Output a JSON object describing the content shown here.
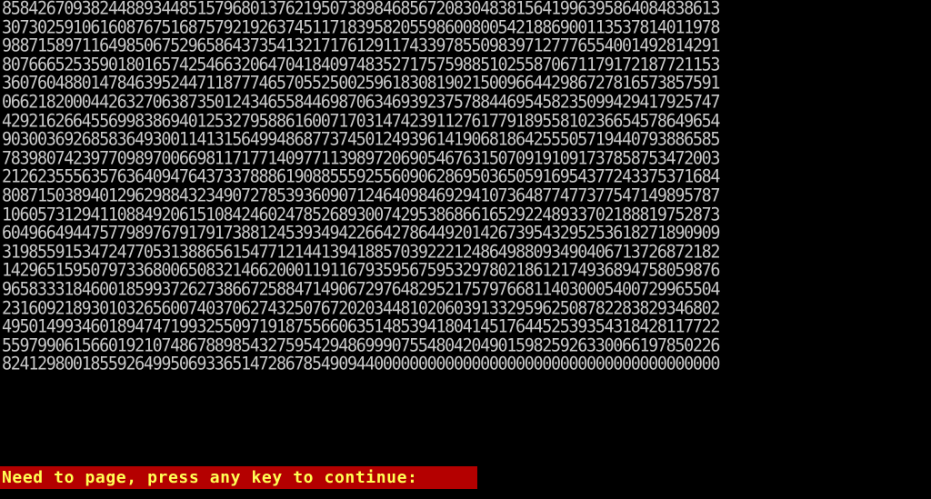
{
  "terminal": {
    "lines": [
      "858426709382448893448515796801376219507389846856720830483815641996395864084838613",
      "307302591061608767516875792192637451171839582055986008005421886900113537814011978",
      "988715897116498506752965864373541321717612911743397855098397127776554001492814291",
      "807666525359018016574254663206470418409748352717575988510255870671179172187721153",
      "360760488014784639524471187774657055250025961830819021500966442986727816573857591",
      "066218200044263270638735012434655844698706346939237578844695458235099429417925747",
      "429216266455699838694012532795886160071703147423911276177918955810236654578649654",
      "903003692685836493001141315649948687737450124939614190681864255505719440793886585",
      "783980742397709897006698117177140977113989720690546763150709191091737858753472003",
      "212623555635763640947643733788861908855592556090628695036505916954377243375371684",
      "808715038940129629884323490727853936090712464098469294107364877477377547149895787",
      "106057312941108849206151084246024785268930074295386866165292248933702188819752873",
      "604966494475779897679179173881245393494226642786449201426739543295253618271890909",
      "319855915347247705313886561547712144139418857039222124864988093490406713726872182",
      "142965159507973368006508321466200011911679359567595329780218612174936894758059876",
      "965833318460018599372627386672588471490672976482952175797668114030005400729965504",
      "231609218930103265600740370627432507672020344810206039133295962508782283829346802",
      "495014993460189474719932550971918755660635148539418041451764452539354318428117722",
      "559799061566019210748678898543275954294869990755480420490159825926330066197850226",
      "824129800185592649950693365147286785490944000000000000000000000000000000000000000"
    ],
    "prompt": "Need to page, press any key to continue:"
  },
  "colors": {
    "background": "#000000",
    "text": "#c8c8c8",
    "prompt_background": "#b40000",
    "prompt_text": "#ffff55"
  }
}
